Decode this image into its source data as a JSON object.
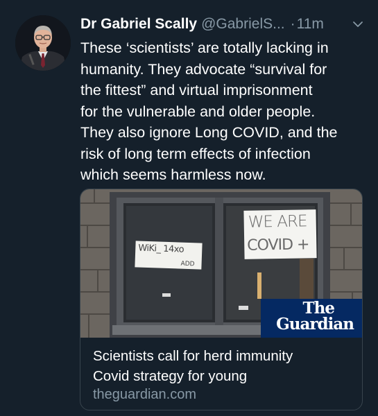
{
  "tweet": {
    "display_name": "Dr Gabriel Scally",
    "handle": "@GabrielS...",
    "separator": "·",
    "time": "11m",
    "text_lines": [
      "These ‘scientists’ are totally lacking in",
      "humanity. They advocate “survival for",
      "the fittest” and virtual imprisonment",
      "for the vulnerable and older people.",
      "They also ignore Long COVID, and the",
      "risk of long term effects of infection",
      "which seems harmless now."
    ]
  },
  "card": {
    "image_signs": {
      "left_sign_line1": "WiKi_ 14xo",
      "left_sign_line2": "ADD",
      "right_sign_line1": "WE ARE",
      "right_sign_line2": "COVID +"
    },
    "logo": {
      "line1": "The",
      "line2": "Guardian"
    },
    "title_lines": [
      "Scientists call for herd immunity",
      "Covid strategy for young"
    ],
    "domain": "theguardian.com"
  },
  "icons": {
    "avatar": "profile-photo",
    "menu": "chevron-down-icon"
  },
  "colors": {
    "background": "#15202b",
    "primary_text": "#ffffff",
    "secondary_text": "#8899a6",
    "card_border": "#38444d",
    "guardian_blue": "#052962"
  }
}
